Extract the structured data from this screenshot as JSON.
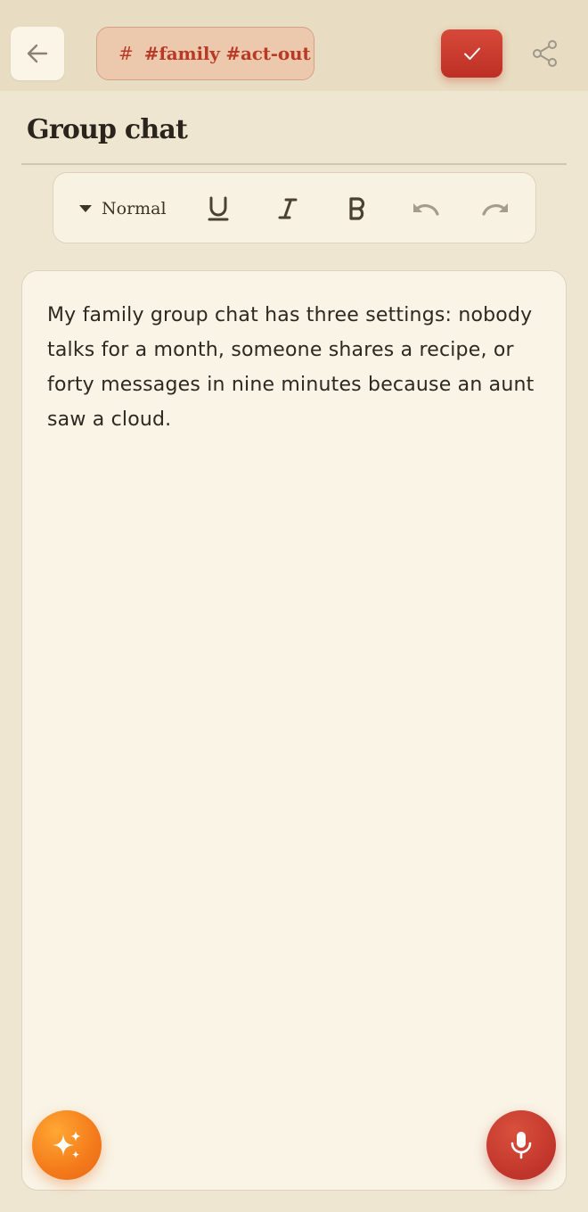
{
  "header": {
    "back_icon": "arrow-left-icon",
    "tag_icon": "hash-icon",
    "tag_hash": "#",
    "tags_label": "#family #act-out",
    "save_icon": "checkmark-icon",
    "share_icon": "share-icon"
  },
  "note": {
    "title": "Group chat",
    "body": "My family group chat has three settings: nobody talks for a month, someone shares a recipe, or forty messages in nine minutes because an aunt saw a cloud."
  },
  "toolbar": {
    "text_style": "Normal",
    "text_style_icon": "caret-down-icon",
    "underline_icon": "underline-icon",
    "italic_icon": "italic-icon",
    "bold_icon": "bold-icon",
    "undo_icon": "undo-icon",
    "redo_icon": "redo-icon"
  },
  "fabs": {
    "magic_icon": "sparkles-icon",
    "mic_icon": "microphone-icon"
  },
  "colors": {
    "accent_red": "#c5352a",
    "accent_orange": "#f47a1a",
    "tag_text": "#b83a26",
    "page_bg": "#efe6d2",
    "editor_bg": "#f9f4e6"
  }
}
